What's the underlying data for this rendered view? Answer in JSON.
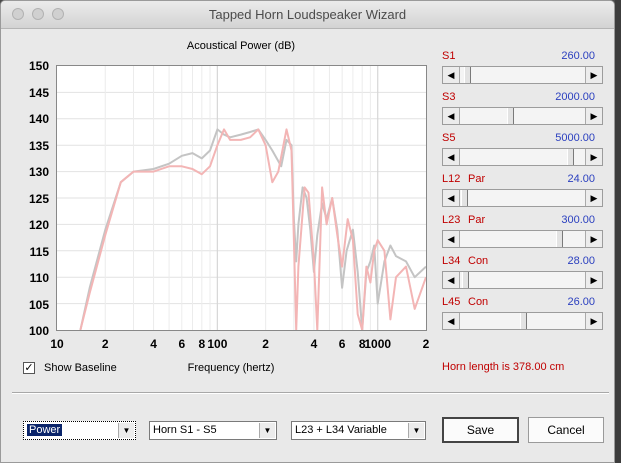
{
  "window": {
    "title": "Tapped Horn Loudspeaker Wizard"
  },
  "chart": {
    "title": "Acoustical Power (dB)",
    "xlabel": "Frequency (hertz)",
    "yticks": [
      "150",
      "145",
      "140",
      "135",
      "130",
      "125",
      "120",
      "115",
      "110",
      "105",
      "100"
    ],
    "xticks": [
      {
        "label": "10",
        "f": 10
      },
      {
        "label": "2",
        "f": 20
      },
      {
        "label": "4",
        "f": 40
      },
      {
        "label": "6",
        "f": 60
      },
      {
        "label": "8",
        "f": 80
      },
      {
        "label": "100",
        "f": 100
      },
      {
        "label": "2",
        "f": 200
      },
      {
        "label": "4",
        "f": 400
      },
      {
        "label": "6",
        "f": 600
      },
      {
        "label": "8",
        "f": 800
      },
      {
        "label": "1000",
        "f": 1000
      },
      {
        "label": "2",
        "f": 2000
      }
    ]
  },
  "chart_data": {
    "type": "line",
    "title": "Acoustical Power (dB)",
    "xlabel": "Frequency (hertz)",
    "ylabel": "",
    "xscale": "log",
    "xlim": [
      10,
      2000
    ],
    "ylim": [
      100,
      150
    ],
    "grid": true,
    "series": [
      {
        "color": "#c4c4c4",
        "points": [
          [
            14,
            100
          ],
          [
            16,
            108
          ],
          [
            20,
            119
          ],
          [
            25,
            128
          ],
          [
            30,
            130
          ],
          [
            40,
            130.5
          ],
          [
            50,
            131.5
          ],
          [
            60,
            133
          ],
          [
            70,
            133.5
          ],
          [
            80,
            132.5
          ],
          [
            90,
            134
          ],
          [
            100,
            138
          ],
          [
            110,
            137
          ],
          [
            120,
            136.5
          ],
          [
            140,
            137
          ],
          [
            160,
            137.5
          ],
          [
            180,
            138
          ],
          [
            200,
            136
          ],
          [
            220,
            134
          ],
          [
            250,
            131
          ],
          [
            270,
            136
          ],
          [
            290,
            135
          ],
          [
            300,
            121
          ],
          [
            310,
            113
          ],
          [
            320,
            120
          ],
          [
            340,
            127
          ],
          [
            360,
            125
          ],
          [
            380,
            119
          ],
          [
            400,
            111
          ],
          [
            420,
            118
          ],
          [
            450,
            124
          ],
          [
            480,
            121
          ],
          [
            520,
            125
          ],
          [
            560,
            119
          ],
          [
            600,
            108
          ],
          [
            640,
            115
          ],
          [
            700,
            119
          ],
          [
            750,
            111
          ],
          [
            800,
            100
          ],
          [
            850,
            111
          ],
          [
            900,
            113
          ],
          [
            950,
            116
          ],
          [
            1000,
            105
          ],
          [
            1100,
            113
          ],
          [
            1200,
            116
          ],
          [
            1300,
            114
          ],
          [
            1500,
            113
          ],
          [
            1700,
            110
          ],
          [
            2000,
            112
          ]
        ]
      },
      {
        "color": "#f3b5b5",
        "points": [
          [
            14,
            100
          ],
          [
            16,
            107
          ],
          [
            20,
            118
          ],
          [
            25,
            128
          ],
          [
            30,
            130
          ],
          [
            40,
            130
          ],
          [
            50,
            131
          ],
          [
            60,
            131
          ],
          [
            70,
            130.5
          ],
          [
            80,
            129.5
          ],
          [
            90,
            131
          ],
          [
            100,
            135
          ],
          [
            110,
            138
          ],
          [
            120,
            136
          ],
          [
            140,
            136
          ],
          [
            160,
            136.5
          ],
          [
            180,
            138
          ],
          [
            200,
            135
          ],
          [
            220,
            128
          ],
          [
            240,
            130
          ],
          [
            270,
            138
          ],
          [
            290,
            134
          ],
          [
            300,
            117
          ],
          [
            310,
            100
          ],
          [
            320,
            112
          ],
          [
            350,
            127
          ],
          [
            370,
            126
          ],
          [
            400,
            113
          ],
          [
            420,
            100
          ],
          [
            450,
            127
          ],
          [
            480,
            120
          ],
          [
            520,
            125
          ],
          [
            560,
            118
          ],
          [
            600,
            112
          ],
          [
            650,
            121
          ],
          [
            700,
            117
          ],
          [
            750,
            103
          ],
          [
            800,
            100
          ],
          [
            850,
            112
          ],
          [
            900,
            109
          ],
          [
            950,
            115
          ],
          [
            1000,
            117
          ],
          [
            1100,
            115
          ],
          [
            1200,
            102
          ],
          [
            1300,
            110
          ],
          [
            1500,
            112
          ],
          [
            1700,
            104
          ],
          [
            2000,
            110
          ]
        ]
      }
    ]
  },
  "show_baseline": {
    "label": "Show Baseline",
    "checked": true,
    "check_glyph": "✓"
  },
  "params": [
    {
      "name": "S1",
      "sub": "",
      "value": "260.00",
      "pos": 0.03
    },
    {
      "name": "S3",
      "sub": "",
      "value": "2000.00",
      "pos": 0.39
    },
    {
      "name": "S5",
      "sub": "",
      "value": "5000.00",
      "pos": 0.89
    },
    {
      "name": "L12",
      "sub": "Par",
      "value": "24.00",
      "pos": 0.01
    },
    {
      "name": "L23",
      "sub": "Par",
      "value": "300.00",
      "pos": 0.8
    },
    {
      "name": "L34",
      "sub": "Con",
      "value": "28.00",
      "pos": 0.02
    },
    {
      "name": "L45",
      "sub": "Con",
      "value": "26.00",
      "pos": 0.5
    }
  ],
  "horn_length": "Horn length is 378.00 cm",
  "combos": [
    {
      "name": "view-select",
      "value": "Power",
      "selected": true
    },
    {
      "name": "horn-range-select",
      "value": "Horn S1 - S5",
      "selected": false
    },
    {
      "name": "variable-select",
      "value": "L23 + L34 Variable",
      "selected": false
    }
  ],
  "buttons": {
    "save": "Save",
    "cancel": "Cancel"
  },
  "icons": {
    "left_arrow": "◀",
    "right_arrow": "▶",
    "down_arrow": "▼"
  }
}
